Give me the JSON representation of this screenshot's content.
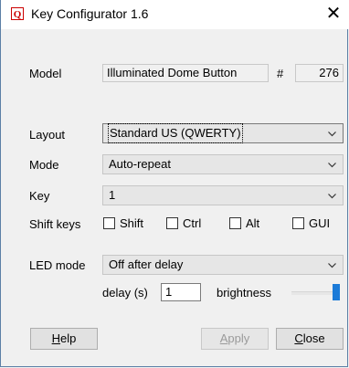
{
  "window": {
    "title": "Key Configurator 1.6",
    "icon_letter": "Q"
  },
  "model": {
    "label": "Model",
    "value": "Illuminated Dome Button",
    "hash_label": "#",
    "number": "276"
  },
  "layout": {
    "label": "Layout",
    "value": "Standard US (QWERTY)"
  },
  "mode": {
    "label": "Mode",
    "value": "Auto-repeat"
  },
  "key": {
    "label": "Key",
    "value": "1"
  },
  "shift_keys": {
    "label": "Shift keys",
    "options": [
      {
        "label": "Shift",
        "checked": false
      },
      {
        "label": "Ctrl",
        "checked": false
      },
      {
        "label": "Alt",
        "checked": false
      },
      {
        "label": "GUI",
        "checked": false
      }
    ]
  },
  "led": {
    "label": "LED mode",
    "value": "Off after delay",
    "delay_label": "delay (s)",
    "delay_value": "1",
    "brightness_label": "brightness",
    "brightness_level": 1.0
  },
  "buttons": {
    "help": {
      "mnemonic": "H",
      "rest": "elp"
    },
    "apply": {
      "mnemonic": "A",
      "rest": "pply",
      "enabled": false
    },
    "close": {
      "mnemonic": "C",
      "rest": "lose"
    }
  },
  "colors": {
    "accent": "#1c7bd8",
    "window_border": "#5b7fa6"
  }
}
